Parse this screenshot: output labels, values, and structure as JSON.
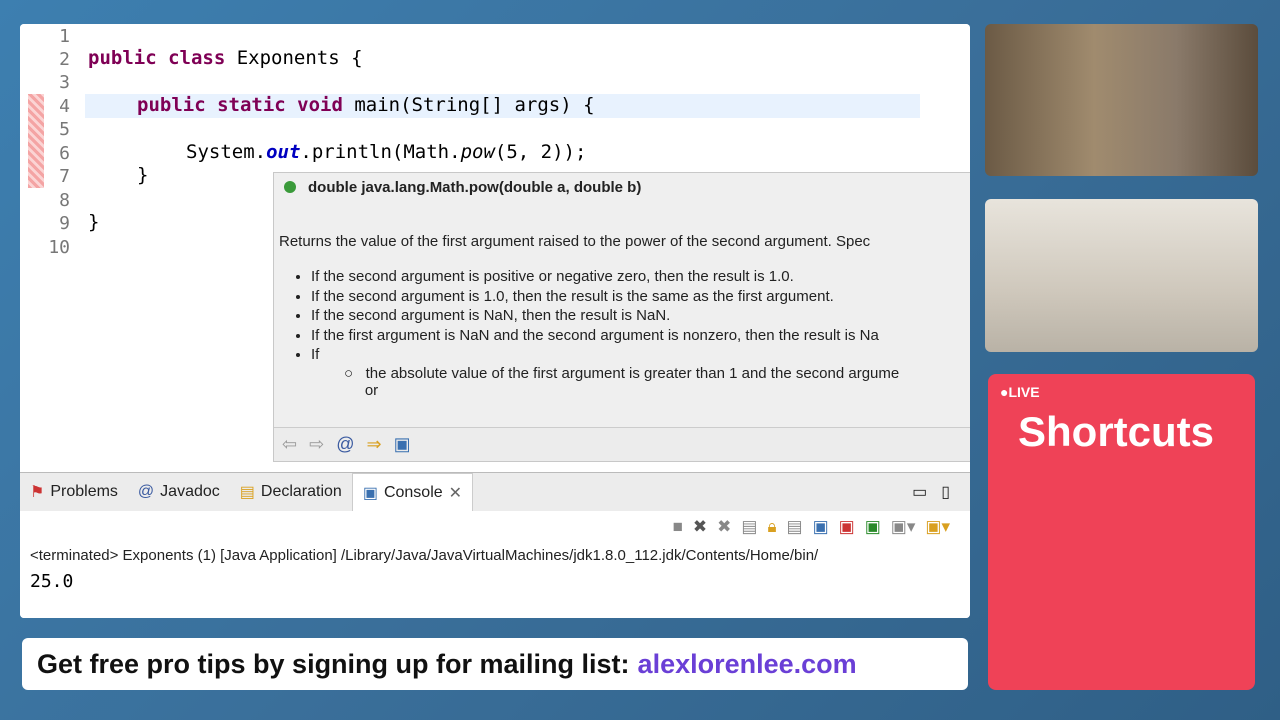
{
  "editor": {
    "lines": [
      "1",
      "2",
      "3",
      "4",
      "5",
      "6",
      "7",
      "8",
      "9",
      "10"
    ],
    "code": {
      "l2a": "public class",
      "l2b": " Exponents {",
      "l4a": "public static void",
      "l4b": " main(String[] args) {",
      "l6a": "System.",
      "l6b": "out",
      "l6c": ".println(Math.",
      "l6d": "pow",
      "l6e": "(5, 2));",
      "l7": "}",
      "l9": "}"
    }
  },
  "popup": {
    "signature": "double java.lang.Math.pow(double a, double b)",
    "description": "Returns the value of the first argument raised to the power of the second argument. Spec",
    "bullets": [
      "If the second argument is positive or negative zero, then the result is 1.0.",
      "If the second argument is 1.0, then the result is the same as the first argument.",
      "If the second argument is NaN, then the result is NaN.",
      "If the first argument is NaN and the second argument is nonzero, then the result is Na",
      "If"
    ],
    "sub_bullet": "the absolute value of the first argument is greater than 1 and the second argume",
    "sub_or": "or"
  },
  "console": {
    "tabs": [
      "Problems",
      "Javadoc",
      "Declaration",
      "Console"
    ],
    "status": "<terminated> Exponents (1) [Java Application] /Library/Java/JavaVirtualMachines/jdk1.8.0_112.jdk/Contents/Home/bin/",
    "output": "25.0"
  },
  "banner": {
    "text": "Get free pro tips by signing up for mailing list:",
    "link": "alexlorenlee.com"
  },
  "card": {
    "live": "●LIVE",
    "title": "Shortcuts",
    "color": "#ef4257"
  }
}
